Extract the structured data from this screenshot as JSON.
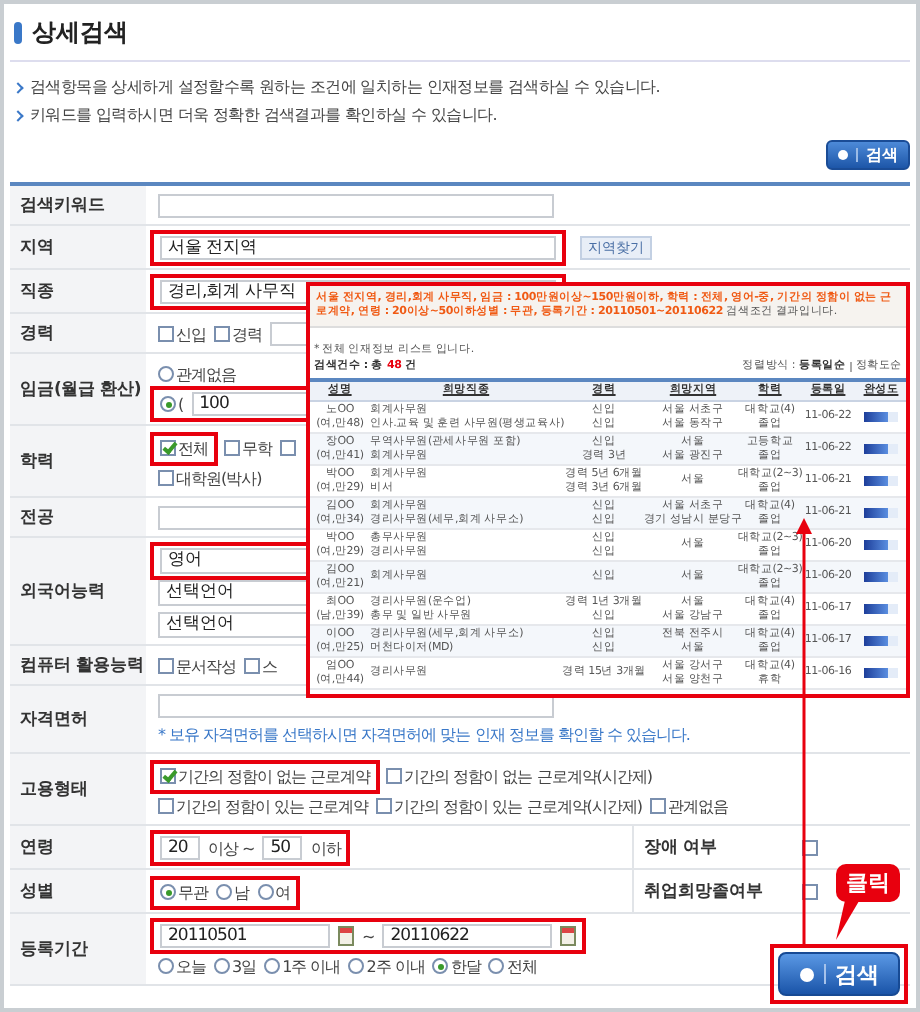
{
  "title": "상세검색",
  "notes": [
    "검색항목을 상세하게 설정할수록 원하는 조건에 일치하는 인재정보를 검색하실 수 있습니다.",
    "키워드를 입력하시면 더욱 정확한 검색결과를 확인하실 수 있습니다."
  ],
  "top_search_button": {
    "label": "검색"
  },
  "form": [
    {
      "label": "검색키워드",
      "lines": [
        [
          {
            "kind": "input"
          }
        ]
      ]
    },
    {
      "label": "지역",
      "lines": [
        [
          {
            "kind": "group",
            "highlighted": true,
            "items": [
              {
                "kind": "input",
                "value": "서울 전지역"
              }
            ]
          },
          {
            "kind": "button",
            "label": "지역찾기"
          }
        ]
      ]
    },
    {
      "label": "직종",
      "lines": [
        [
          {
            "kind": "group",
            "highlighted": true,
            "items": [
              {
                "kind": "input",
                "value": "경리,회계 사무직"
              }
            ]
          }
        ]
      ]
    },
    {
      "label": "경력",
      "lines": [
        [
          {
            "kind": "checkbox",
            "label": "신입",
            "checked": false
          },
          {
            "kind": "checkbox",
            "label": "경력",
            "checked": false
          },
          {
            "kind": "number"
          }
        ]
      ]
    },
    {
      "label": "임금(월급 환산)",
      "lines": [
        [
          {
            "kind": "radio",
            "label": "관계없음",
            "selected": false
          }
        ],
        [
          {
            "kind": "group",
            "highlighted": true,
            "items": [
              {
                "kind": "radio",
                "label": "(",
                "selected": true
              },
              {
                "kind": "input",
                "value": "100"
              }
            ]
          }
        ]
      ]
    },
    {
      "label": "학력",
      "lines": [
        [
          {
            "kind": "group",
            "highlighted": true,
            "items": [
              {
                "kind": "checkbox",
                "label": "전체",
                "checked": true
              }
            ]
          },
          {
            "kind": "checkbox",
            "label": "무학",
            "checked": false
          },
          {
            "kind": "checkbox",
            "checked": false
          }
        ],
        [
          {
            "kind": "checkbox",
            "label": "대학원(박사)",
            "checked": false
          }
        ]
      ]
    },
    {
      "label": "전공",
      "lines": [
        [
          {
            "kind": "input"
          }
        ]
      ]
    },
    {
      "label": "외국어능력",
      "lines": [
        [
          {
            "kind": "group",
            "highlighted": true,
            "items": [
              {
                "kind": "select",
                "value": "영어"
              }
            ]
          }
        ],
        [
          {
            "kind": "select",
            "value": "선택언어"
          }
        ],
        [
          {
            "kind": "select",
            "value": "선택언어"
          }
        ]
      ]
    },
    {
      "label": "컴퓨터 활용능력",
      "lines": [
        [
          {
            "kind": "checkbox",
            "label": "문서작성",
            "checked": false
          },
          {
            "kind": "checkbox",
            "label": "스",
            "checked": false
          }
        ]
      ]
    },
    {
      "label": "자격면허",
      "lines": [
        [
          {
            "kind": "input"
          }
        ],
        [
          {
            "kind": "note",
            "text": "* 보유 자격면허를 선택하시면 자격면허에 맞는 인재 정보를 확인할 수 있습니다."
          }
        ]
      ]
    },
    {
      "label": "고용형태",
      "lines": [
        [
          {
            "kind": "group",
            "highlighted": true,
            "items": [
              {
                "kind": "checkbox",
                "label": "기간의 정함이 없는 근로계약",
                "checked": true
              }
            ]
          },
          {
            "kind": "checkbox",
            "label": "기간의 정함이 없는 근로계약(시간제)",
            "checked": false
          }
        ],
        [
          {
            "kind": "checkbox",
            "label": "기간의 정함이 있는 근로계약",
            "checked": false
          },
          {
            "kind": "checkbox",
            "label": "기간의 정함이 있는 근로계약(시간제)",
            "checked": false
          },
          {
            "kind": "checkbox",
            "label": "관계없음",
            "checked": false
          }
        ]
      ]
    },
    {
      "label": "연령",
      "side": {
        "label": "장애 여부",
        "checked": false
      },
      "lines": [
        [
          {
            "kind": "group",
            "highlighted": true,
            "items": [
              {
                "kind": "number",
                "value": "20"
              },
              {
                "kind": "text",
                "text": "이상 ~"
              },
              {
                "kind": "number",
                "value": "50"
              },
              {
                "kind": "text",
                "text": "이하"
              }
            ]
          }
        ]
      ]
    },
    {
      "label": "성별",
      "side": {
        "label": "취업희망졸여부",
        "checked": false
      },
      "lines": [
        [
          {
            "kind": "group",
            "highlighted": true,
            "items": [
              {
                "kind": "radio",
                "label": "무관",
                "selected": true
              },
              {
                "kind": "radio",
                "label": "남",
                "selected": false
              },
              {
                "kind": "radio",
                "label": "여",
                "selected": false
              }
            ]
          }
        ]
      ]
    },
    {
      "label": "등록기간",
      "lines": [
        [
          {
            "kind": "group",
            "highlighted": true,
            "items": [
              {
                "kind": "date",
                "value": "20110501"
              },
              {
                "kind": "text",
                "text": "~"
              },
              {
                "kind": "date",
                "value": "20110622"
              }
            ]
          }
        ],
        [
          {
            "kind": "radio",
            "label": "오늘",
            "selected": false
          },
          {
            "kind": "radio",
            "label": "3일",
            "selected": false
          },
          {
            "kind": "radio",
            "label": "1주 이내",
            "selected": false
          },
          {
            "kind": "radio",
            "label": "2주 이내",
            "selected": false
          },
          {
            "kind": "radio",
            "label": "한달",
            "selected": true
          },
          {
            "kind": "radio",
            "label": "전체",
            "selected": false
          }
        ]
      ]
    }
  ],
  "popup": {
    "summary": "서울 전지역, 경리,회계 사무직, 임금 : 100만원이상~150만원이하, 학력 : 전체, 영어-중, 기간의 정함이 없는 근로계약, 연령 : 20이상~50이하성별 : 무관, 등록기간 : 20110501~20110622",
    "summary_tail": "검색조건 결과입니다.",
    "list_note": "* 전체 인재정보 리스트 입니다.",
    "count_label": "검색건수 : 총",
    "count": "48",
    "count_unit": "건",
    "sort_label": "정렬방식 :",
    "sort_options": [
      {
        "label": "등록일순",
        "selected": true
      },
      {
        "label": "정확도순",
        "selected": false
      }
    ],
    "columns": [
      "성명",
      "희망직종",
      "경력",
      "희망지역",
      "학력",
      "등록일",
      "완성도"
    ],
    "rows": [
      {
        "name": "노OO",
        "info": "(여,만48)",
        "jobs": [
          "회계사무원",
          "인사.교육 및 훈련 사무원(평생교육사)"
        ],
        "career": [
          "신입",
          "신입"
        ],
        "regions": [
          "서울 서초구",
          "서울 동작구"
        ],
        "education": [
          "대학교(4)",
          "졸업"
        ],
        "date": "11-06-22",
        "level": 0.7
      },
      {
        "name": "장OO",
        "info": "(여,만41)",
        "jobs": [
          "무역사무원(관세사무원 포함)",
          "회계사무원"
        ],
        "career": [
          "신입",
          "경력 3년"
        ],
        "regions": [
          "서울",
          "서울 광진구"
        ],
        "education": [
          "고등학교",
          "졸업"
        ],
        "date": "11-06-22",
        "level": 0.7
      },
      {
        "name": "박OO",
        "info": "(여,만29)",
        "jobs": [
          "회계사무원",
          "비서"
        ],
        "career": [
          "경력 5년 6개월",
          "경력 3년 6개월"
        ],
        "regions": [
          "서울"
        ],
        "education": [
          "대학교(2~3)",
          "졸업"
        ],
        "date": "11-06-21",
        "level": 0.7
      },
      {
        "name": "김OO",
        "info": "(여,만34)",
        "jobs": [
          "회계사무원",
          "경리사무원(세무,회계 사무소)"
        ],
        "career": [
          "신입",
          "신입"
        ],
        "regions": [
          "서울 서초구",
          "경기 성남시 분당구"
        ],
        "education": [
          "대학교(4)",
          "졸업"
        ],
        "date": "11-06-21",
        "level": 0.7
      },
      {
        "name": "박OO",
        "info": "(여,만29)",
        "jobs": [
          "총무사무원",
          "경리사무원"
        ],
        "career": [
          "신입",
          "신입"
        ],
        "regions": [
          "서울"
        ],
        "education": [
          "대학교(2~3)",
          "졸업"
        ],
        "date": "11-06-20",
        "level": 0.7
      },
      {
        "name": "김OO",
        "info": "(여,만21)",
        "jobs": [
          "회계사무원"
        ],
        "career": [
          "신입"
        ],
        "regions": [
          "서울"
        ],
        "education": [
          "대학교(2~3)",
          "졸업"
        ],
        "date": "11-06-20",
        "level": 0.7
      },
      {
        "name": "최OO",
        "info": "(남,만39)",
        "jobs": [
          "경리사무원(운수업)",
          "총무 및 일반 사무원"
        ],
        "career": [
          "경력 1년 3개월",
          "신입"
        ],
        "regions": [
          "서울",
          "서울 강남구"
        ],
        "education": [
          "대학교(4)",
          "졸업"
        ],
        "date": "11-06-17",
        "level": 0.7
      },
      {
        "name": "이OO",
        "info": "(여,만25)",
        "jobs": [
          "경리사무원(세무,회계 사무소)",
          "머천다이저(MD)"
        ],
        "career": [
          "신입",
          "신입"
        ],
        "regions": [
          "전북 전주시",
          "서울"
        ],
        "education": [
          "대학교(4)",
          "졸업"
        ],
        "date": "11-06-17",
        "level": 0.7
      },
      {
        "name": "엄OO",
        "info": "(여,만44)",
        "jobs": [
          "경리사무원"
        ],
        "career": [
          "경력 15년 3개월"
        ],
        "regions": [
          "서울 강서구",
          "서울 양천구"
        ],
        "education": [
          "대학교(4)",
          "휴학"
        ],
        "date": "11-06-16",
        "level": 0.7
      }
    ]
  },
  "callout": {
    "text": "클릭"
  },
  "search_button": {
    "label": "검색",
    "highlighted": true
  }
}
